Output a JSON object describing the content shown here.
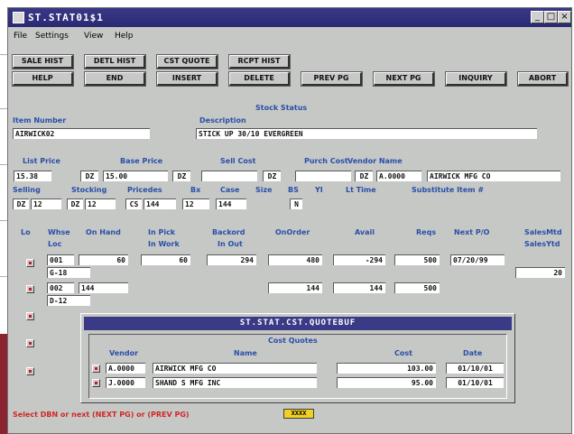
{
  "window": {
    "title": "ST.STAT01$1",
    "min_glyph": "_",
    "max_glyph": "□",
    "close_glyph": "×"
  },
  "menu": [
    "File",
    "Settings",
    "View",
    "Help"
  ],
  "toolbar": {
    "row1": [
      "SALE HIST",
      "DETL HIST",
      "CST QUOTE",
      "RCPT HIST"
    ],
    "row2": [
      "HELP",
      "END",
      "INSERT",
      "DELETE",
      "PREV PG",
      "NEXT PG",
      "INQUIRY",
      "ABORT"
    ]
  },
  "stock": {
    "section_title": "Stock Status",
    "item_number_label": "Item Number",
    "item_number": "AIRWICK02",
    "description_label": "Description",
    "description": "STICK UP 30/10 EVERGREEN",
    "list_price_label": "List Price",
    "list_price": "15.38",
    "list_price_unit": "DZ",
    "base_price_label": "Base Price",
    "base_price": "15.00",
    "base_price_unit": "DZ",
    "sell_cost_label": "Sell Cost",
    "sell_cost": "",
    "sell_cost_unit": "DZ",
    "purch_cost_label": "Purch Cost",
    "vendor_name_label": "Vendor Name",
    "purch_cost": "",
    "purch_cost_unit": "DZ",
    "vendor_code": "A.0000",
    "vendor_name": "AIRWICK MFG CO",
    "selling_label": "Selling",
    "selling_unit": "DZ",
    "selling_qty": "12",
    "stocking_label": "Stocking",
    "stocking_unit": "DZ",
    "stocking_qty": "12",
    "pricedes_label": "Pricedes",
    "pricedes_unit": "CS",
    "pricedes_qty": "144",
    "bx_label": "Bx",
    "bx_value": "12",
    "case_label": "Case",
    "case_value": "144",
    "size_label": "Size",
    "bs_label": "BS",
    "bs_value": "N",
    "yi_label": "YI",
    "lead_time_label": "Lt Time",
    "substitute_label": "Substitute Item #"
  },
  "warehouse": {
    "headers": {
      "lo": "Lo",
      "whse": "Whse",
      "loc": "Loc",
      "on_hand": "On Hand",
      "in_pick": "In Pick",
      "in_work": "In Work",
      "backord": "Backord",
      "in_out": "In Out",
      "on_order": "OnOrder",
      "avail": "Avail",
      "reqs": "Reqs",
      "next_po": "Next P/O",
      "sales_mtd": "SalesMtd",
      "sales_ytd": "SalesYtd"
    },
    "rows": [
      {
        "whse": "001",
        "loc": "G-18",
        "on_hand": "60",
        "in_pick": "60",
        "backord": "294",
        "on_order": "480",
        "avail": "-294",
        "reqs": "500",
        "next_po": "07/20/99",
        "sales": "20"
      },
      {
        "whse": "002",
        "loc": "D-12",
        "on_hand": "144",
        "in_pick": "",
        "backord": "",
        "on_order": "144",
        "avail": "144",
        "reqs": "500",
        "next_po": "",
        "sales": ""
      }
    ]
  },
  "quote_dialog": {
    "title": "ST.STAT.CST.QUOTEBUF",
    "section_title": "Cost Quotes",
    "headers": {
      "vendor": "Vendor",
      "name": "Name",
      "cost": "Cost",
      "date": "Date"
    },
    "rows": [
      {
        "vendor": "A.0000",
        "name": "AIRWICK MFG CO",
        "cost": "103.00",
        "date": "01/10/01"
      },
      {
        "vendor": "J.0000",
        "name": "SHAND S MFG INC",
        "cost": "95.00",
        "date": "01/10/01"
      }
    ]
  },
  "status": {
    "message": "Select DBN or next (NEXT PG) or (PREV PG)",
    "mode": "XXXX"
  }
}
